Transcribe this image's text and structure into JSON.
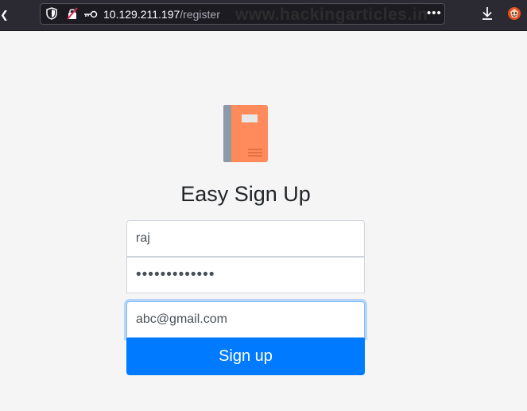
{
  "browser": {
    "url_host": "10.129.211.197",
    "url_path": "/register",
    "watermark": "www.hackingarticles.in",
    "page_actions": "•••"
  },
  "page": {
    "title": "Easy Sign Up",
    "form": {
      "username_value": "raj",
      "password_value": "•••••••••••••",
      "email_value": "abc@gmail.com",
      "submit_label": "Sign up"
    }
  },
  "icons": {
    "logo": "book-icon",
    "shield": "shield-icon",
    "insecure": "insecure-connection-icon",
    "key": "key-icon",
    "download": "download-icon",
    "addon": "addon-icon"
  },
  "colors": {
    "primary": "#007bff",
    "book_cover": "#ff8a5b",
    "book_spine": "#8c9aa8",
    "page_bg": "#f5f5f5",
    "browser_bg": "#2b2a33"
  }
}
